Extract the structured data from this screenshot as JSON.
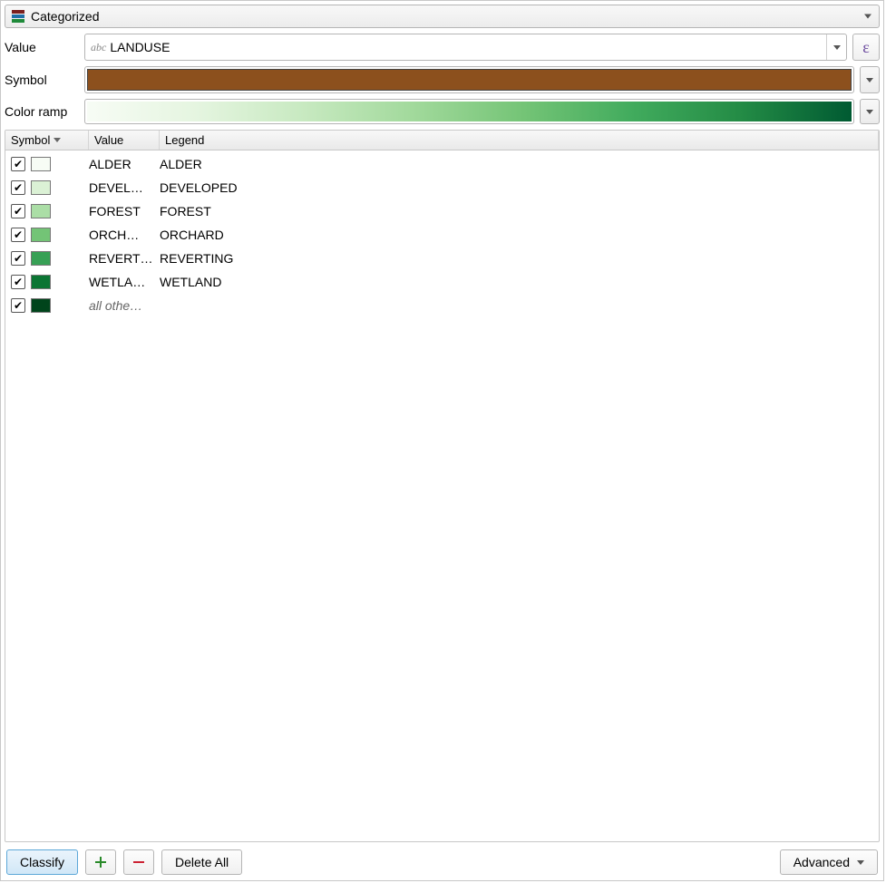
{
  "mode": {
    "label": "Categorized"
  },
  "form": {
    "value_label": "Value",
    "value_field": "LANDUSE",
    "value_prefix": "abc",
    "symbol_label": "Symbol",
    "symbol_color": "#8c501d",
    "colorramp_label": "Color ramp"
  },
  "table": {
    "headers": {
      "symbol": "Symbol",
      "value": "Value",
      "legend": "Legend"
    },
    "rows": [
      {
        "checked": true,
        "color": "#f7fcf5",
        "value": "ALDER",
        "legend": "ALDER"
      },
      {
        "checked": true,
        "color": "#dbf1d5",
        "value": "DEVEL…",
        "legend": "DEVELOPED"
      },
      {
        "checked": true,
        "color": "#abdea6",
        "value": "FOREST",
        "legend": "FOREST"
      },
      {
        "checked": true,
        "color": "#73c476",
        "value": "ORCH…",
        "legend": "ORCHARD"
      },
      {
        "checked": true,
        "color": "#37a055",
        "value": "REVERT…",
        "legend": "REVERTING"
      },
      {
        "checked": true,
        "color": "#0b7533",
        "value": "WETLA…",
        "legend": "WETLAND"
      },
      {
        "checked": true,
        "color": "#00441b",
        "value": "all othe…",
        "legend": "",
        "italic": true
      }
    ]
  },
  "buttons": {
    "classify": "Classify",
    "delete_all": "Delete All",
    "advanced": "Advanced"
  }
}
